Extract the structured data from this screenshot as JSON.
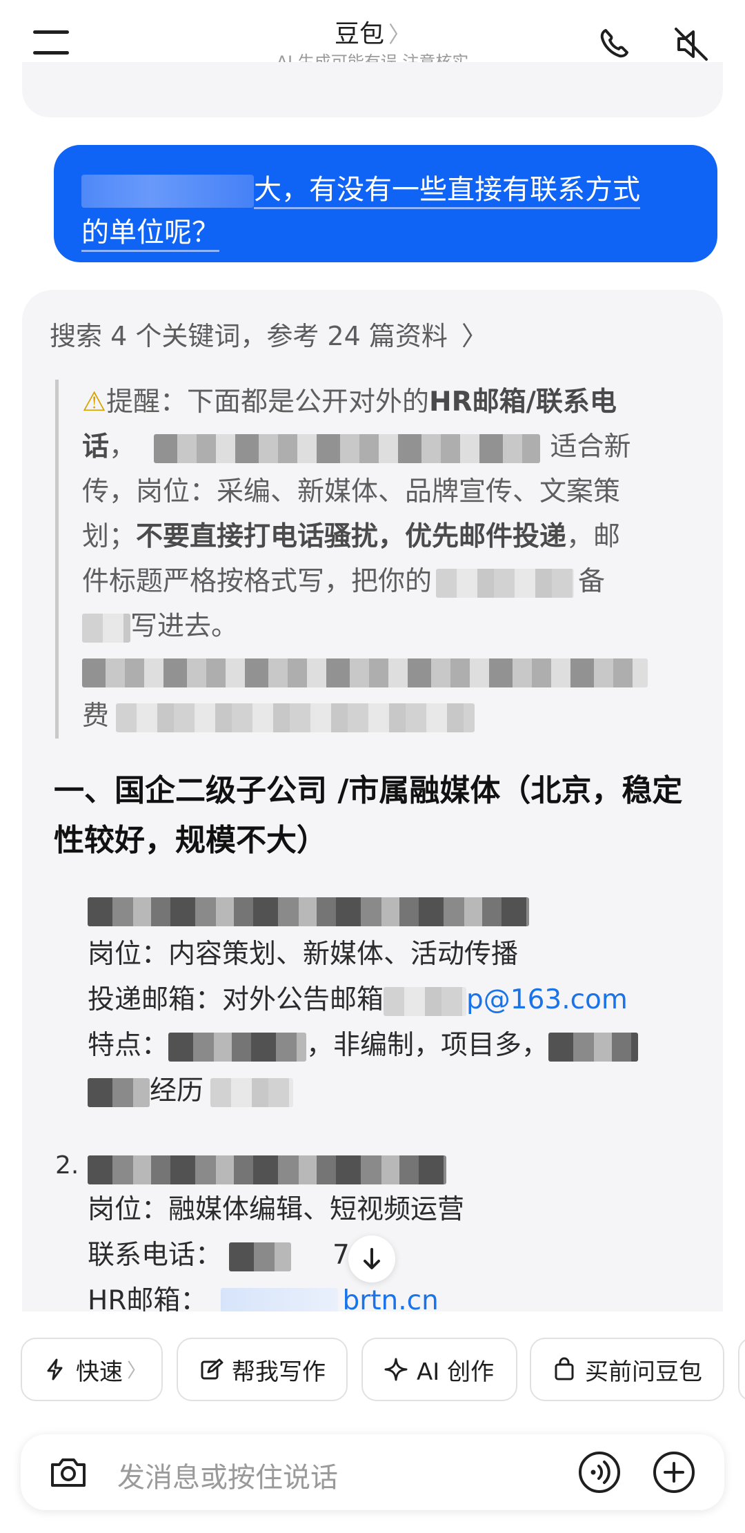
{
  "header": {
    "title": "豆包",
    "title_chevron": "〉",
    "subtitle": "AI 生成可能有误 注意核实",
    "icons": [
      "menu-icon",
      "phone-icon",
      "speaker-muted-icon"
    ]
  },
  "user_message": {
    "text_visible": "大，有没有一些直接有联系方式",
    "text_line2": "的单位呢？"
  },
  "ai_reply": {
    "search_summary": "搜索 4 个关键词，参考 24 篇资料",
    "search_chevron": "〉",
    "reminder": {
      "icon": "warning-icon",
      "prefix": "提醒：下面都是公开对外的",
      "bold1": "HR邮箱/联系电",
      "bold1b": "话",
      "part_a": "，",
      "part_b": "适合新",
      "line3": "传，岗位：采编、新媒体、品牌宣传、文案策",
      "line4a": "划；",
      "bold2": "不要直接打电话骚扰，优先邮件投递",
      "line4b": "，邮",
      "line5a": "件标题严格按格式写，把你的",
      "line5b": "备",
      "line6": "写进去。",
      "line8a": "费"
    },
    "section1_title": "一、国企二级子公司 /市属融媒体（北京，稳定性较好，规模不大）",
    "item1": {
      "position": "岗位：内容策划、新媒体、活动传播",
      "email_label": "投递邮箱：对外公告邮箱",
      "email_partial": "p@163.com",
      "features_label": "特点：",
      "features_mid": "，非编制，项目多，",
      "features_tail": "经历"
    },
    "item2": {
      "number": "2.",
      "position": "岗位：融媒体编辑、短视频运营",
      "phone_label": "联系电话：",
      "phone_partial": "74",
      "hr_label": "HR邮箱：",
      "hr_partial": "brtn.cn"
    }
  },
  "chips": [
    {
      "label": "快速",
      "icon": "lightning-icon",
      "chevron": "〉"
    },
    {
      "label": "帮我写作",
      "icon": "edit-icon"
    },
    {
      "label": "AI 创作",
      "icon": "sparkle-icon"
    },
    {
      "label": "买前问豆包",
      "icon": "shopping-bag-icon"
    }
  ],
  "input": {
    "placeholder": "发消息或按住说话",
    "icons": [
      "camera-icon",
      "voice-call-icon",
      "plus-icon"
    ]
  }
}
